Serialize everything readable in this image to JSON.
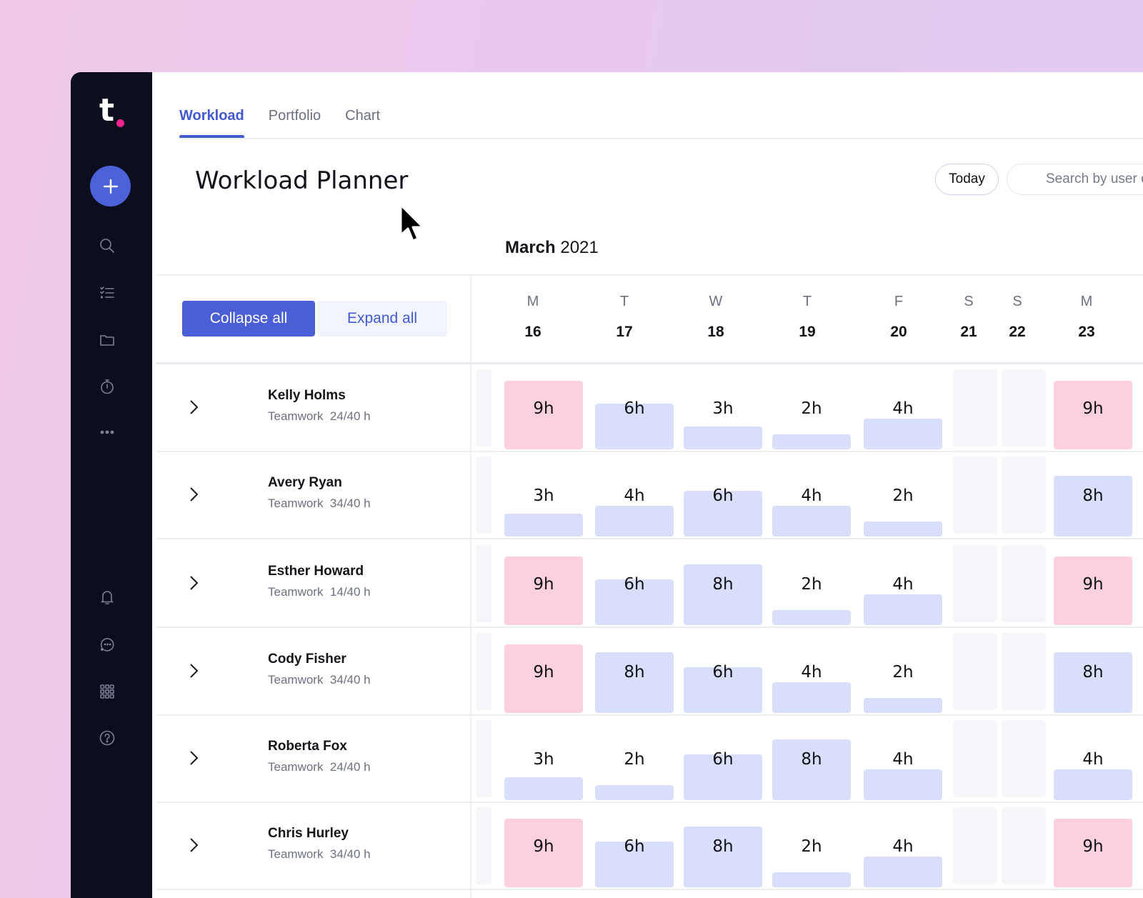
{
  "brand": {
    "logo_letter": "t",
    "accent": "#4a5fd6",
    "logo_dot": "#f0258f"
  },
  "sidebar": {
    "add_button": {
      "icon": "plus-icon"
    },
    "top_items": [
      {
        "icon": "search-icon"
      },
      {
        "icon": "tasks-checklist-icon"
      },
      {
        "icon": "folder-icon"
      },
      {
        "icon": "timer-icon"
      },
      {
        "icon": "more-dots-icon"
      }
    ],
    "bottom_items": [
      {
        "icon": "bell-icon"
      },
      {
        "icon": "chat-icon"
      },
      {
        "icon": "apps-grid-icon"
      },
      {
        "icon": "help-icon"
      }
    ]
  },
  "tabs": [
    {
      "label": "Workload",
      "active": true
    },
    {
      "label": "Portfolio",
      "active": false
    },
    {
      "label": "Chart",
      "active": false
    }
  ],
  "header": {
    "title": "Workload Planner",
    "today_label": "Today",
    "search_placeholder": "Search by user or company"
  },
  "calendar": {
    "month": "March",
    "year": "2021",
    "collapse_label": "Collapse all",
    "expand_label": "Expand all",
    "days": [
      {
        "letter": "M",
        "num": "16",
        "weekend": false
      },
      {
        "letter": "T",
        "num": "17",
        "weekend": false
      },
      {
        "letter": "W",
        "num": "18",
        "weekend": false
      },
      {
        "letter": "T",
        "num": "19",
        "weekend": false
      },
      {
        "letter": "F",
        "num": "20",
        "weekend": false
      },
      {
        "letter": "S",
        "num": "21",
        "weekend": true
      },
      {
        "letter": "S",
        "num": "22",
        "weekend": true
      },
      {
        "letter": "M",
        "num": "23",
        "weekend": false
      }
    ],
    "capacity_hours": 8,
    "colors": {
      "normal": "#d9defa",
      "over": "#fcd0dc",
      "weekend": "#f5f6f9"
    }
  },
  "people": [
    {
      "name": "Kelly Holms",
      "project": "Teamwork",
      "hours": "24/40 h",
      "days": [
        9,
        6,
        3,
        2,
        4,
        null,
        null,
        9
      ]
    },
    {
      "name": "Avery Ryan",
      "project": "Teamwork",
      "hours": "34/40 h",
      "days": [
        3,
        4,
        6,
        4,
        2,
        null,
        null,
        8
      ]
    },
    {
      "name": "Esther Howard",
      "project": "Teamwork",
      "hours": "14/40 h",
      "days": [
        9,
        6,
        8,
        2,
        4,
        null,
        null,
        9
      ]
    },
    {
      "name": "Cody Fisher",
      "project": "Teamwork",
      "hours": "34/40 h",
      "days": [
        9,
        8,
        6,
        4,
        2,
        null,
        null,
        8
      ]
    },
    {
      "name": "Roberta Fox",
      "project": "Teamwork",
      "hours": "24/40 h",
      "days": [
        3,
        2,
        6,
        8,
        4,
        null,
        null,
        4
      ]
    },
    {
      "name": "Chris Hurley",
      "project": "Teamwork",
      "hours": "34/40 h",
      "days": [
        9,
        6,
        8,
        2,
        4,
        null,
        null,
        9
      ]
    }
  ]
}
